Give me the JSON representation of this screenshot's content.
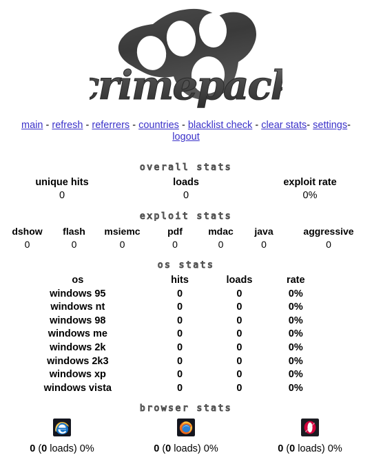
{
  "site": {
    "logo_text": "crimepack",
    "logo_alt": "brass-knuckles-logo"
  },
  "nav": {
    "separator": " - ",
    "items": [
      {
        "label": "main"
      },
      {
        "label": "refresh"
      },
      {
        "label": "referrers"
      },
      {
        "label": "countries"
      },
      {
        "label": "blacklist check"
      },
      {
        "label": "clear stats"
      },
      {
        "label": "settings"
      },
      {
        "label": "logout"
      }
    ]
  },
  "overall_stats": {
    "heading": "overall stats",
    "columns": [
      {
        "label": "unique hits",
        "value": "0"
      },
      {
        "label": "loads",
        "value": "0"
      },
      {
        "label": "exploit rate",
        "value": "0%"
      }
    ]
  },
  "exploit_stats": {
    "heading": "exploit stats",
    "columns": [
      {
        "label": "dshow",
        "value": "0"
      },
      {
        "label": "flash",
        "value": "0"
      },
      {
        "label": "msiemc",
        "value": "0"
      },
      {
        "label": "pdf",
        "value": "0"
      },
      {
        "label": "mdac",
        "value": "0"
      },
      {
        "label": "java",
        "value": "0"
      },
      {
        "label": "aggressive",
        "value": "0"
      }
    ]
  },
  "os_stats": {
    "heading": "os stats",
    "headers": [
      "os",
      "hits",
      "loads",
      "rate"
    ],
    "rows": [
      {
        "os": "windows 95",
        "hits": "0",
        "loads": "0",
        "rate": "0%"
      },
      {
        "os": "windows nt",
        "hits": "0",
        "loads": "0",
        "rate": "0%"
      },
      {
        "os": "windows 98",
        "hits": "0",
        "loads": "0",
        "rate": "0%"
      },
      {
        "os": "windows me",
        "hits": "0",
        "loads": "0",
        "rate": "0%"
      },
      {
        "os": "windows 2k",
        "hits": "0",
        "loads": "0",
        "rate": "0%"
      },
      {
        "os": "windows 2k3",
        "hits": "0",
        "loads": "0",
        "rate": "0%"
      },
      {
        "os": "windows xp",
        "hits": "0",
        "loads": "0",
        "rate": "0%"
      },
      {
        "os": "windows vista",
        "hits": "0",
        "loads": "0",
        "rate": "0%"
      }
    ]
  },
  "browser_stats": {
    "heading": "browser stats",
    "browsers": [
      {
        "icon": "internet-explorer-icon",
        "hits": "0",
        "loads": "0",
        "rate": "0%",
        "loads_suffix": " loads) "
      },
      {
        "icon": "firefox-icon",
        "hits": "0",
        "loads": "0",
        "rate": "0%",
        "loads_suffix": " loads) "
      },
      {
        "icon": "opera-icon",
        "hits": "0",
        "loads": "0",
        "rate": "0%",
        "loads_suffix": " loads) "
      }
    ]
  },
  "colors": {
    "link": "#3a31c9",
    "text": "#000000",
    "background": "#ffffff",
    "logo_dark": "#3f3f3f",
    "logo_mid": "#6b6b6b",
    "stencil_outline": "#5a5a5a"
  }
}
